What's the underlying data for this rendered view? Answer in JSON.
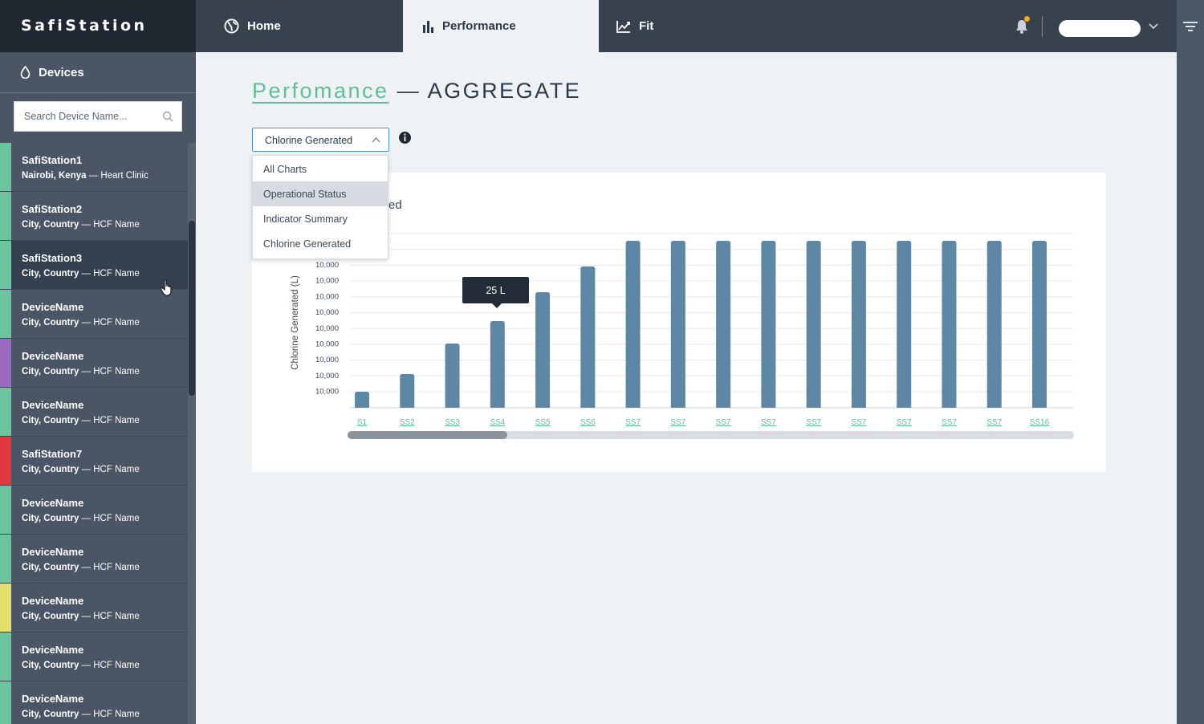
{
  "app": {
    "brand": "SafiStation"
  },
  "nav": {
    "tabs": [
      {
        "label": "Home",
        "icon": "globe-icon"
      },
      {
        "label": "Performance",
        "icon": "bar-chart-icon"
      },
      {
        "label": "Fit",
        "icon": "line-chart-icon"
      }
    ],
    "active_tab": "Performance"
  },
  "sidebar": {
    "header": "Devices",
    "search_placeholder": "Search Device Name...",
    "devices": [
      {
        "name": "SafiStation1",
        "location": "Nairobi, Kenya",
        "facility": "Heart Clinic",
        "status_color": "#6cc49f",
        "active": false
      },
      {
        "name": "SafiStation2",
        "location": "City, Country",
        "facility": "HCF Name",
        "status_color": "#6cc49f",
        "active": false
      },
      {
        "name": "SafiStation3",
        "location": "City, Country",
        "facility": "HCF Name",
        "status_color": "#6cc49f",
        "active": true
      },
      {
        "name": "DeviceName",
        "location": "City, Country",
        "facility": "HCF Name",
        "status_color": "#6cc49f",
        "active": false
      },
      {
        "name": "DeviceName",
        "location": "City, Country",
        "facility": "HCF Name",
        "status_color": "#9b6bc2",
        "active": false
      },
      {
        "name": "DeviceName",
        "location": "City, Country",
        "facility": "HCF Name",
        "status_color": "#6cc49f",
        "active": false
      },
      {
        "name": "SafiStation7",
        "location": "City, Country",
        "facility": "HCF Name",
        "status_color": "#e0383e",
        "active": false
      },
      {
        "name": "DeviceName",
        "location": "City, Country",
        "facility": "HCF Name",
        "status_color": "#6cc49f",
        "active": false
      },
      {
        "name": "DeviceName",
        "location": "City, Country",
        "facility": "HCF Name",
        "status_color": "#6cc49f",
        "active": false
      },
      {
        "name": "DeviceName",
        "location": "City, Country",
        "facility": "HCF Name",
        "status_color": "#e3df6a",
        "active": false
      },
      {
        "name": "DeviceName",
        "location": "City, Country",
        "facility": "HCF Name",
        "status_color": "#6cc49f",
        "active": false
      },
      {
        "name": "DeviceName",
        "location": "City, Country",
        "facility": "HCF Name",
        "status_color": "#6cc49f",
        "active": false
      }
    ]
  },
  "main": {
    "title_link": "Perfomance",
    "title_rest": "— AGGREGATE",
    "select": {
      "value": "Chlorine Generated",
      "options": [
        "All Charts",
        "Operational Status",
        "Indicator Summary",
        "Chlorine Generated"
      ],
      "highlighted": "Operational Status"
    },
    "card_title_visible": "ed",
    "tooltip": "25 L"
  },
  "chart_data": {
    "type": "bar",
    "ylabel": "Chlorine Generated (L)",
    "ytick_labels": [
      "10,000",
      "10,000",
      "10,000",
      "10,000",
      "10,000",
      "10,000",
      "10,000",
      "10,000",
      "10,000"
    ],
    "categories": [
      "S1",
      "SS2",
      "SS3",
      "SS4",
      "SS5",
      "SS6",
      "SS7",
      "SS7",
      "SS7",
      "SS7",
      "SS7",
      "SS7",
      "SS7",
      "SS7",
      "SS7",
      "SS16"
    ],
    "values": [
      10,
      21,
      40,
      54,
      72,
      88,
      104,
      104,
      104,
      104,
      104,
      104,
      104,
      104,
      104,
      104
    ],
    "ylim": [
      0,
      110
    ],
    "bar_color": "#5e87a6",
    "grid": true,
    "scrollbar_fraction": 0.22
  },
  "colors": {
    "accent": "#65bc98",
    "topbar": "#37424e",
    "sidebar": "#4a5665"
  }
}
